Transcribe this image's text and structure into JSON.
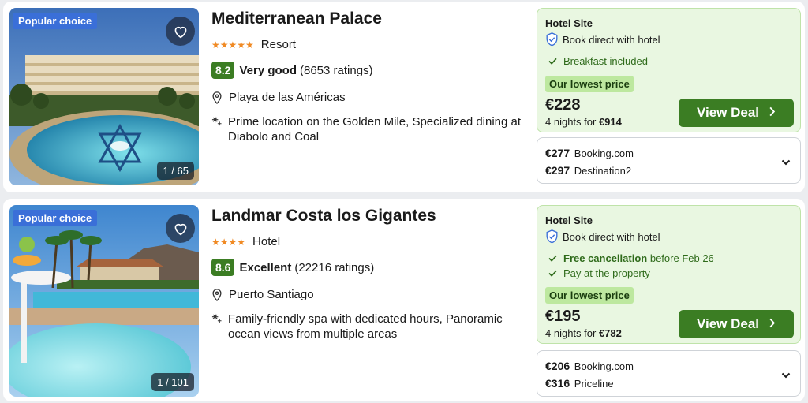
{
  "listings": [
    {
      "badge": "Popular choice",
      "photo_counter": "1 / 65",
      "name": "Mediterranean Palace",
      "stars": "★★★★★",
      "star_count": 5,
      "type": "Resort",
      "score": "8.2",
      "rating_word": "Very good",
      "rating_count": "(8653 ratings)",
      "location": "Playa de las Américas",
      "features": "Prime location on the Golden Mile, Specialized dining at Diabolo and Coal",
      "deal": {
        "site": "Hotel Site",
        "direct": "Book direct with hotel",
        "perks": [
          {
            "strong": "",
            "text": "Breakfast included"
          }
        ],
        "lowest_label": "Our lowest price",
        "price": "€228",
        "nights_prefix": "4 nights for",
        "nights_total": "€914",
        "button": "View Deal"
      },
      "others": [
        {
          "price": "€277",
          "site": "Booking.com"
        },
        {
          "price": "€297",
          "site": "Destination2"
        }
      ]
    },
    {
      "badge": "Popular choice",
      "photo_counter": "1 / 101",
      "name": "Landmar Costa los Gigantes",
      "stars": "★★★★",
      "star_count": 4,
      "type": "Hotel",
      "score": "8.6",
      "rating_word": "Excellent",
      "rating_count": "(22216 ratings)",
      "location": "Puerto Santiago",
      "features": "Family-friendly spa with dedicated hours, Panoramic ocean views from multiple areas",
      "deal": {
        "site": "Hotel Site",
        "direct": "Book direct with hotel",
        "perks": [
          {
            "strong": "Free cancellation",
            "text": "before Feb 26"
          },
          {
            "strong": "",
            "text": "Pay at the property"
          }
        ],
        "lowest_label": "Our lowest price",
        "price": "€195",
        "nights_prefix": "4 nights for",
        "nights_total": "€782",
        "button": "View Deal"
      },
      "others": [
        {
          "price": "€206",
          "site": "Booking.com"
        },
        {
          "price": "€316",
          "site": "Priceline"
        }
      ]
    }
  ],
  "colors": {
    "accent_green": "#3b7d23",
    "deal_bg": "#e9f7e1",
    "badge_blue": "#3a6fd8",
    "star_orange": "#f08a24"
  },
  "icons": [
    "heart-icon",
    "map-pin-icon",
    "sparkle-icon",
    "shield-check-icon",
    "check-icon",
    "chevron-right-icon",
    "chevron-down-icon"
  ]
}
